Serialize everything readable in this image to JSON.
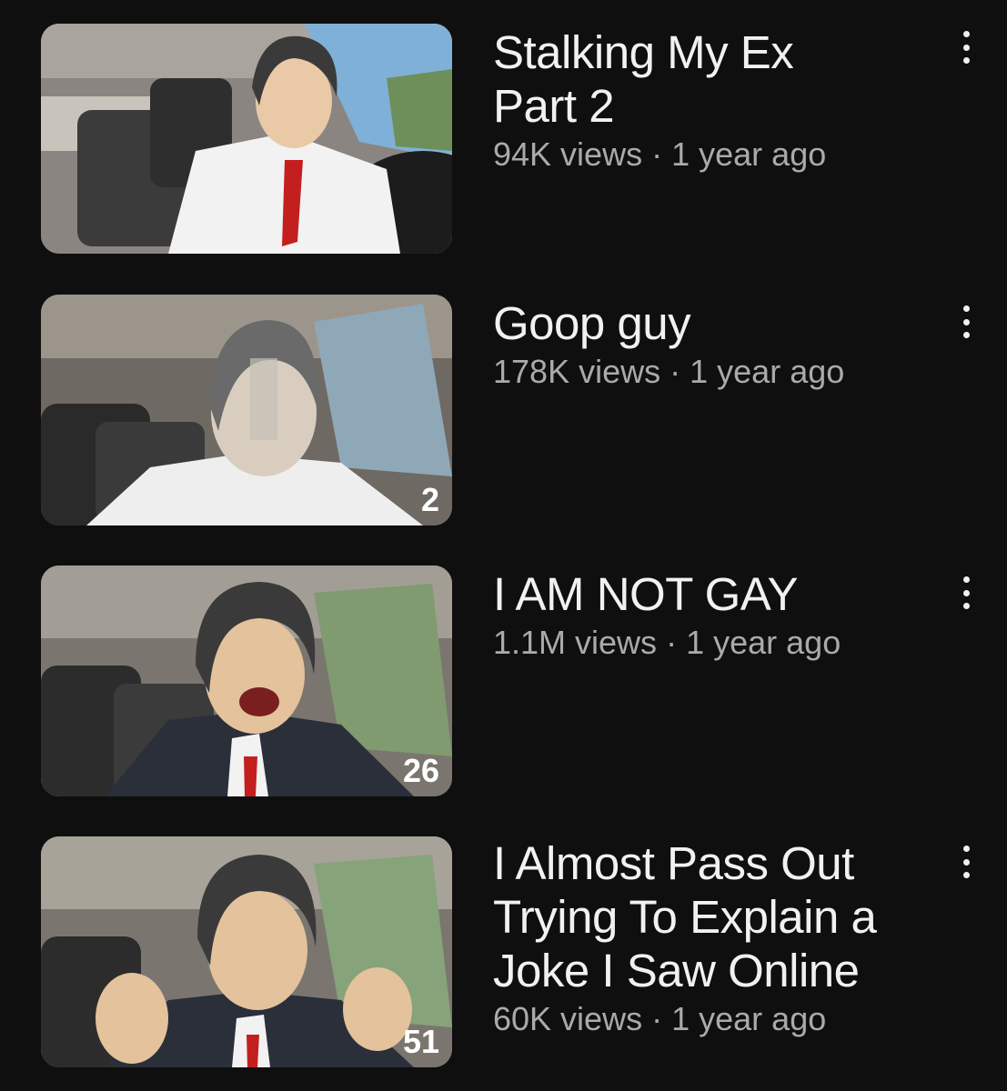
{
  "videos": [
    {
      "title_lines": [
        "Stalking My Ex",
        "Part 2"
      ],
      "views": "94K views",
      "separator": "·",
      "age": "1 year ago",
      "badge": "",
      "menu_icon": "more-vert-icon"
    },
    {
      "title_lines": [
        "Goop guy"
      ],
      "views": "178K views",
      "separator": "·",
      "age": "1 year ago",
      "badge": "2",
      "menu_icon": "more-vert-icon"
    },
    {
      "title_lines": [
        "I AM NOT GAY"
      ],
      "views": "1.1M views",
      "separator": "·",
      "age": "1 year ago",
      "badge": "26",
      "menu_icon": "more-vert-icon"
    },
    {
      "title_lines": [
        "I Almost Pass Out",
        "Trying To Explain a",
        "Joke I Saw Online"
      ],
      "views": "60K views",
      "separator": "·",
      "age": "1 year ago",
      "badge": "51",
      "menu_icon": "more-vert-icon"
    }
  ],
  "colors": {
    "background": "#0f0f0f",
    "title": "#f1f1f1",
    "subtitle": "#aaaaaa"
  }
}
